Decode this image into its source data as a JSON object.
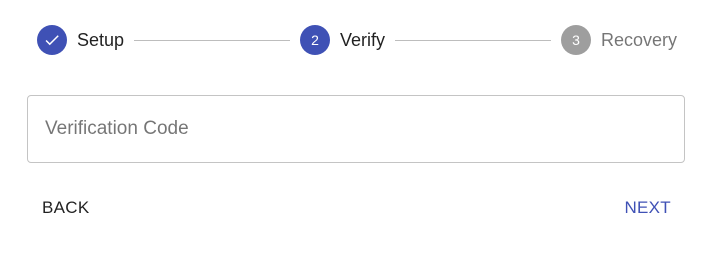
{
  "stepper": {
    "steps": [
      {
        "label": "Setup",
        "number": "1",
        "state": "completed"
      },
      {
        "label": "Verify",
        "number": "2",
        "state": "active"
      },
      {
        "label": "Recovery",
        "number": "3",
        "state": "pending"
      }
    ]
  },
  "form": {
    "verification_code": {
      "placeholder": "Verification Code",
      "value": ""
    }
  },
  "actions": {
    "back_label": "BACK",
    "next_label": "NEXT"
  },
  "colors": {
    "primary": "#3f51b5",
    "pending": "#9e9e9e",
    "connector": "#bdbdbd"
  }
}
